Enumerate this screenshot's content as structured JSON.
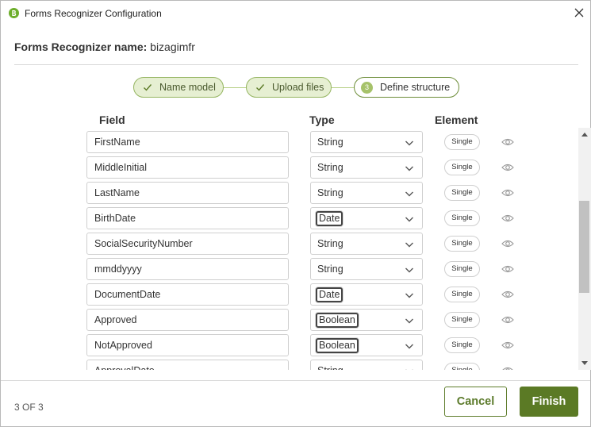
{
  "window": {
    "title": "Forms Recognizer Configuration",
    "icon": "bizagi-logo-icon",
    "close_icon": "close-icon"
  },
  "header": {
    "name_label": "Forms Recognizer name:",
    "name_value": "bizagimfr"
  },
  "stepper": {
    "steps": [
      {
        "label": "Name model",
        "state": "done"
      },
      {
        "label": "Upload files",
        "state": "done"
      },
      {
        "label": "Define structure",
        "state": "current",
        "number": "3"
      }
    ]
  },
  "table": {
    "headers": {
      "field": "Field",
      "type": "Type",
      "element": "Element"
    },
    "rows": [
      {
        "field": "FirstName",
        "type": "String",
        "element": "Single"
      },
      {
        "field": "MiddleInitial",
        "type": "String",
        "element": "Single"
      },
      {
        "field": "LastName",
        "type": "String",
        "element": "Single"
      },
      {
        "field": "BirthDate",
        "type": "Date",
        "element": "Single"
      },
      {
        "field": "SocialSecurityNumber",
        "type": "String",
        "element": "Single"
      },
      {
        "field": "mmddyyyy",
        "type": "String",
        "element": "Single"
      },
      {
        "field": "DocumentDate",
        "type": "Date",
        "element": "Single"
      },
      {
        "field": "Approved",
        "type": "Boolean",
        "element": "Single"
      },
      {
        "field": "NotApproved",
        "type": "Boolean",
        "element": "Single"
      },
      {
        "field": "ApprovalDate",
        "type": "String",
        "element": "Single"
      }
    ]
  },
  "footer": {
    "page_count": "3 OF 3",
    "cancel_label": "Cancel",
    "finish_label": "Finish"
  },
  "colors": {
    "accent": "#5b7a25",
    "step_done_bg": "#e6efd2",
    "step_border": "#95b561"
  }
}
